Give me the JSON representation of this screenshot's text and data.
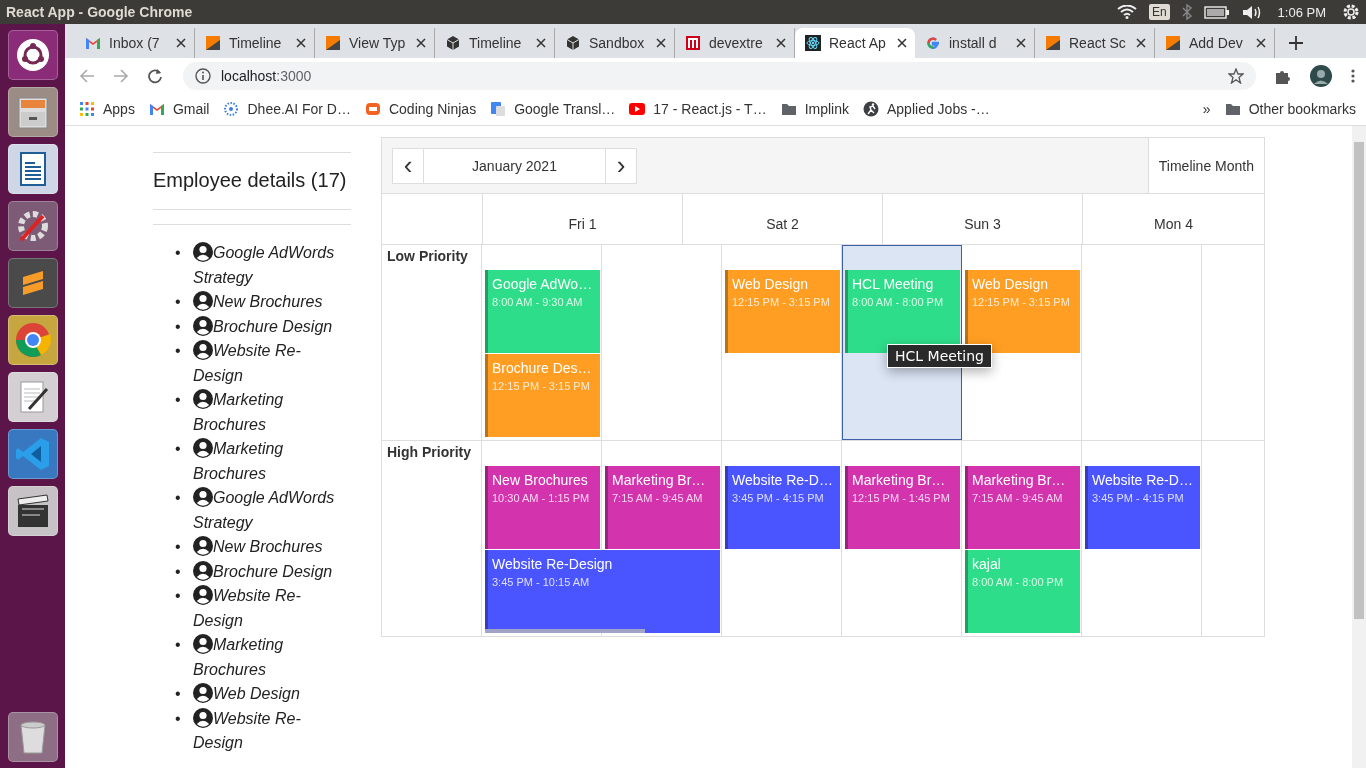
{
  "system_bar": {
    "title": "React App - Google Chrome",
    "keyboard": "En",
    "clock": "1:06 PM"
  },
  "browser": {
    "tabs": [
      {
        "title": "Inbox (7",
        "selected": false
      },
      {
        "title": "Timeline",
        "selected": false
      },
      {
        "title": "View Typ",
        "selected": false
      },
      {
        "title": "Timeline",
        "selected": false
      },
      {
        "title": "Sandbox",
        "selected": false
      },
      {
        "title": "devextre",
        "selected": false
      },
      {
        "title": "React Ap",
        "selected": true
      },
      {
        "title": "install d",
        "selected": false
      },
      {
        "title": "React Sc",
        "selected": false
      },
      {
        "title": "Add Dev",
        "selected": false
      }
    ],
    "address": {
      "host": "localhost",
      "port": ":3000"
    },
    "bookmarks": [
      "Apps",
      "Gmail",
      "Dhee.AI For D…",
      "Coding Ninjas",
      "Google Transl…",
      "17 - React.js - T…",
      "Implink",
      "Applied Jobs -…"
    ],
    "more": "»",
    "other_bookmarks": "Other bookmarks"
  },
  "employees": {
    "title": "Employee details (17)",
    "items": [
      {
        "marker": "•",
        "label": "Google AdWords Strategy"
      },
      {
        "marker": "•",
        "label": "New Brochures"
      },
      {
        "marker": "•",
        "label": "Brochure Design"
      },
      {
        "marker": "•",
        "label": "Website Re-Design"
      },
      {
        "marker": "•",
        "label": "Marketing Brochures"
      },
      {
        "marker": "•",
        "label": "Marketing Brochures"
      },
      {
        "marker": "•",
        "label": "Google AdWords Strategy"
      },
      {
        "marker": "•",
        "label": "New Brochures"
      },
      {
        "marker": "•",
        "label": "Brochure Design"
      },
      {
        "marker": "•",
        "label": "Website Re-Design"
      },
      {
        "marker": "•",
        "label": "Marketing Brochures"
      },
      {
        "marker": "•",
        "label": "Web Design"
      },
      {
        "marker": "•",
        "label": "Website Re-Design"
      }
    ]
  },
  "scheduler": {
    "prev": "‹",
    "period": "January 2021",
    "next": "›",
    "views": [
      {
        "label": "Timeline Month",
        "selected": true
      }
    ],
    "days": [
      "Fri 1",
      "Sat 2",
      "Sun 3",
      "Mon 4"
    ],
    "groups": [
      {
        "name": "Low Priority",
        "cells": [
          {
            "selected": false,
            "appointments": [
              {
                "title": "Google AdWo…",
                "time": "8:00 AM - 9:30 AM",
                "color": "#2edd89"
              },
              {
                "title": "Brochure Des…",
                "time": "12:15 PM - 3:15 PM",
                "color": "#ff9e22"
              }
            ]
          },
          {
            "selected": false
          },
          {
            "selected": false,
            "appointments": [
              {
                "title": "Web Design",
                "time": "12:15 PM - 3:15 PM",
                "color": "#ff9e22"
              }
            ]
          },
          {
            "selected": true,
            "appointments": [
              {
                "title": "HCL Meeting",
                "time": "8:00 AM - 8:00 PM",
                "color": "#2edd89"
              }
            ],
            "tooltip": "HCL Meeting"
          },
          {
            "selected": false,
            "appointments": [
              {
                "title": "Web Design",
                "time": "12:15 PM - 3:15 PM",
                "color": "#ff9e22"
              }
            ]
          },
          {
            "selected": false
          },
          {
            "selected": false
          }
        ]
      },
      {
        "name": "High Priority",
        "cells": [
          {
            "selected": false,
            "appointments": [
              {
                "title": "New Brochures",
                "time": "10:30 AM - 1:15 PM",
                "color": "#d433ae"
              },
              {
                "kind": "multiday",
                "title": "Website Re-Design",
                "time": "3:45 PM - 10:15 AM",
                "color": "#4a55ff"
              }
            ]
          },
          {
            "selected": false,
            "appointments": [
              {
                "title": "Marketing Br…",
                "time": "7:15 AM - 9:45 AM",
                "color": "#d433ae"
              }
            ]
          },
          {
            "selected": false,
            "appointments": [
              {
                "title": "Website Re-D…",
                "time": "3:45 PM - 4:15 PM",
                "color": "#4a55ff"
              }
            ]
          },
          {
            "selected": false,
            "appointments": [
              {
                "title": "Marketing Br…",
                "time": "12:15 PM - 1:45 PM",
                "color": "#d433ae"
              }
            ]
          },
          {
            "selected": false,
            "appointments": [
              {
                "title": "Marketing Br…",
                "time": "7:15 AM - 9:45 AM",
                "color": "#d433ae"
              },
              {
                "title": "kajal",
                "time": "8:00 AM - 8:00 PM",
                "color": "#2edd89"
              }
            ]
          },
          {
            "selected": false,
            "appointments": [
              {
                "title": "Website Re-D…",
                "time": "3:45 PM - 4:15 PM",
                "color": "#4a55ff"
              }
            ]
          },
          {
            "selected": false
          }
        ]
      }
    ]
  }
}
